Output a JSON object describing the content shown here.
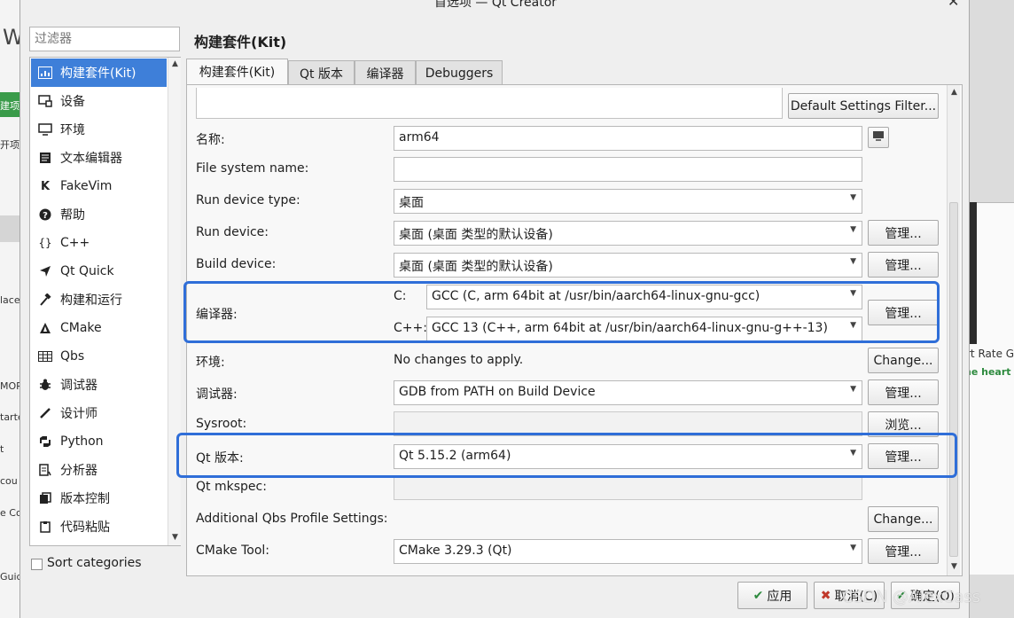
{
  "window": {
    "title": "首选项 — Qt Creator"
  },
  "filter": {
    "placeholder": "过滤器"
  },
  "categories": [
    {
      "label": "构建套件(Kit)",
      "icon": "kit-icon",
      "selected": true
    },
    {
      "label": "设备",
      "icon": "device-icon"
    },
    {
      "label": "环境",
      "icon": "monitor-icon"
    },
    {
      "label": "文本编辑器",
      "icon": "text-editor-icon"
    },
    {
      "label": "FakeVim",
      "icon": "fakevim-icon"
    },
    {
      "label": "帮助",
      "icon": "help-icon"
    },
    {
      "label": "C++",
      "icon": "braces-icon"
    },
    {
      "label": "Qt Quick",
      "icon": "qt-quick-icon"
    },
    {
      "label": "构建和运行",
      "icon": "hammer-icon"
    },
    {
      "label": "CMake",
      "icon": "cmake-icon"
    },
    {
      "label": "Qbs",
      "icon": "qbs-icon"
    },
    {
      "label": "调试器",
      "icon": "bug-icon"
    },
    {
      "label": "设计师",
      "icon": "pencil-icon"
    },
    {
      "label": "Python",
      "icon": "python-icon"
    },
    {
      "label": "分析器",
      "icon": "analyzer-icon"
    },
    {
      "label": "版本控制",
      "icon": "vcs-icon"
    },
    {
      "label": "代码粘贴",
      "icon": "clipboard-icon"
    }
  ],
  "sort_categories": {
    "label": "Sort categories",
    "checked": false
  },
  "page": {
    "title": "构建套件(Kit)"
  },
  "tabs": [
    {
      "label": "构建套件(Kit)",
      "active": true
    },
    {
      "label": "Qt 版本"
    },
    {
      "label": "编译器"
    },
    {
      "label": "Debuggers"
    }
  ],
  "form": {
    "default_settings_filter_label": "Default Settings Filter...",
    "name": {
      "label": "名称:",
      "value": "arm64"
    },
    "file_system_name": {
      "label": "File system name:",
      "value": ""
    },
    "run_device_type": {
      "label": "Run device type:",
      "value": "桌面"
    },
    "run_device": {
      "label": "Run device:",
      "value": "桌面 (桌面 类型的默认设备)",
      "button": "管理..."
    },
    "build_device": {
      "label": "Build device:",
      "value": "桌面 (桌面 类型的默认设备)",
      "button": "管理..."
    },
    "compiler": {
      "label": "编译器:",
      "c_label": "C:",
      "c_value": "GCC (C, arm 64bit at /usr/bin/aarch64-linux-gnu-gcc)",
      "cpp_label": "C++:",
      "cpp_value": "GCC 13 (C++, arm 64bit at /usr/bin/aarch64-linux-gnu-g++-13)",
      "button": "管理..."
    },
    "environment": {
      "label": "环境:",
      "value": "No changes to apply.",
      "button": "Change..."
    },
    "debugger": {
      "label": "调试器:",
      "value": "GDB from PATH on Build Device",
      "button": "管理..."
    },
    "sysroot": {
      "label": "Sysroot:",
      "value": "",
      "button": "浏览..."
    },
    "qt_version": {
      "label": "Qt 版本:",
      "value": "Qt 5.15.2 (arm64)",
      "button": "管理..."
    },
    "qt_mkspec": {
      "label": "Qt mkspec:",
      "value": ""
    },
    "qbs_profile": {
      "label": "Additional Qbs Profile Settings:",
      "button": "Change..."
    },
    "cmake_tool": {
      "label": "CMake Tool:",
      "value": "CMake 3.29.3 (Qt)",
      "button": "管理..."
    }
  },
  "footer": {
    "apply": "应用",
    "cancel": "取消(C)",
    "ok": "确定(O)"
  },
  "background": {
    "left_fragments": [
      "W",
      "建项",
      "开项",
      "lace",
      "MOR",
      "tarte",
      "t",
      "cou",
      "e Co",
      "Guid"
    ],
    "right_fragments": [
      "rt Rate Ga",
      "ne  heart l"
    ]
  },
  "watermark": "CSDN @AlexCass",
  "colors": {
    "accent": "#3e7fd9",
    "highlight_border": "#2f6ed8"
  }
}
